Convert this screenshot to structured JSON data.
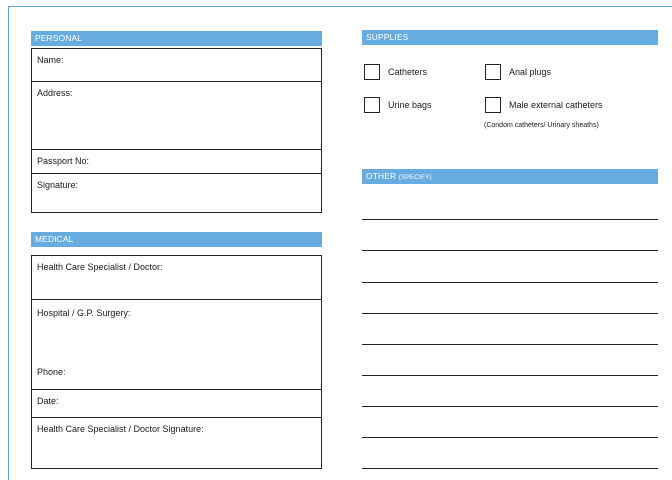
{
  "personal": {
    "header": "PERSONAL",
    "fields": [
      "Name:",
      "Address:",
      "Passport No:",
      "Signature:"
    ]
  },
  "medical": {
    "header": "MEDICAL",
    "fields": [
      "Health Care Specialist / Doctor:",
      "Hospital / G.P. Surgery:",
      "Phone:",
      "Date:",
      "Health Care Specialist / Doctor Signature:"
    ]
  },
  "supplies": {
    "header": "SUPPLIES",
    "items": [
      "Catheters",
      "Anal plugs",
      "Urine bags",
      "Male external catheters"
    ],
    "note": "(Condom catheters/ Urinary sheaths)"
  },
  "other": {
    "header": "OTHER",
    "header_small": "(SPECIFY)",
    "line_count": 9
  }
}
